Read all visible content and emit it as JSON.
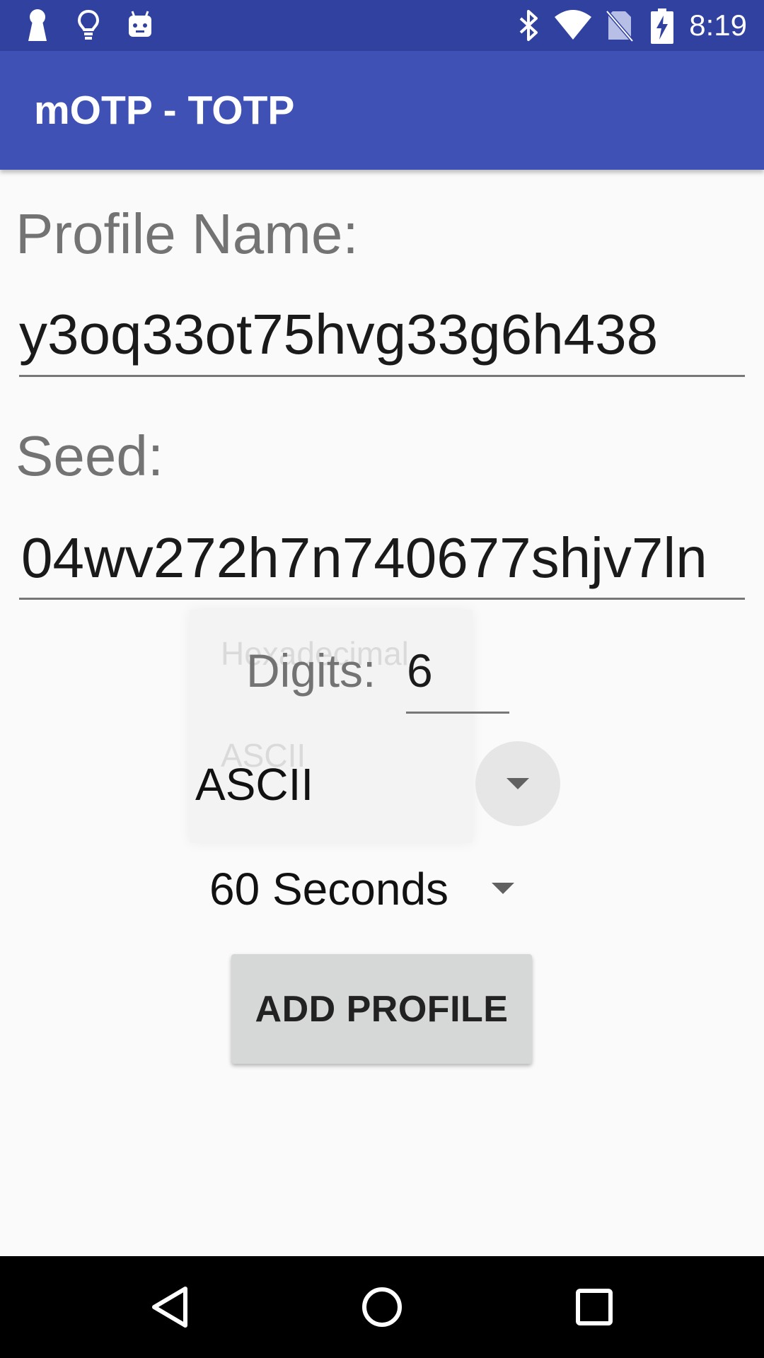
{
  "status_bar": {
    "time": "8:19",
    "left_icons": [
      "keyhole-icon",
      "lightbulb-icon",
      "android-icon"
    ],
    "right_icons": [
      "bluetooth-icon",
      "wifi-icon",
      "no-sim-icon",
      "battery-charging-icon"
    ]
  },
  "app_bar": {
    "title": "mOTP - TOTP"
  },
  "form": {
    "profile_name_label": "Profile Name:",
    "profile_name_value": "y3oq33ot75hvg33g6h438",
    "seed_label": "Seed:",
    "seed_value": "04wv272h7n740677shjv7ln",
    "digits_label": "Digits:",
    "digits_value": "6",
    "encoding_selected": "ASCII",
    "encoding_options": [
      "Hexadecimal",
      "ASCII"
    ],
    "period_selected": "60 Seconds",
    "add_button_label": "ADD PROFILE"
  },
  "nav_bar": {
    "icons": [
      "back-icon",
      "home-icon",
      "recents-icon"
    ]
  },
  "colors": {
    "status_bar": "#3041a0",
    "app_bar": "#3f51b5",
    "background": "#fafafa",
    "button": "#d6d7d7"
  }
}
